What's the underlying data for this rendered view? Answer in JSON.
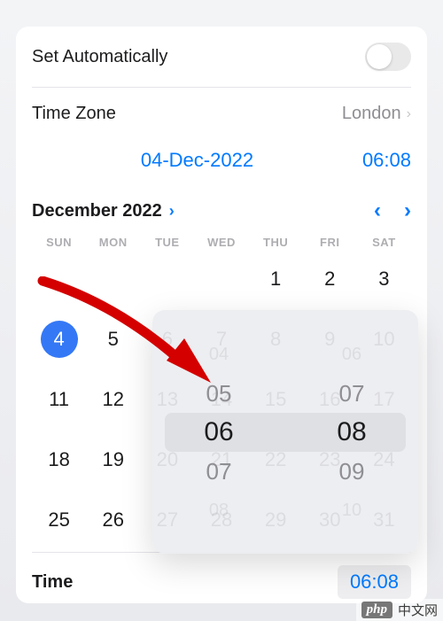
{
  "rows": {
    "set_auto_label": "Set Automatically",
    "set_auto_on": false,
    "time_zone_label": "Time Zone",
    "time_zone_value": "London"
  },
  "display": {
    "date": "04-Dec-2022",
    "time": "06:08"
  },
  "calendar": {
    "month_year": "December 2022",
    "weekdays": [
      "SUN",
      "MON",
      "TUE",
      "WED",
      "THU",
      "FRI",
      "SAT"
    ],
    "cells": [
      "",
      "",
      "",
      "",
      "1",
      "2",
      "3",
      "4",
      "5",
      "6",
      "7",
      "8",
      "9",
      "10",
      "11",
      "12",
      "13",
      "14",
      "15",
      "16",
      "17",
      "18",
      "19",
      "20",
      "21",
      "22",
      "23",
      "24",
      "25",
      "26",
      "27",
      "28",
      "29",
      "30",
      "31"
    ],
    "selected_day": "4"
  },
  "time_row": {
    "label": "Time",
    "value": "06:08"
  },
  "picker": {
    "hours": [
      "04",
      "05",
      "06",
      "07",
      "08"
    ],
    "minutes": [
      "06",
      "07",
      "08",
      "09",
      "10"
    ]
  },
  "watermark": {
    "logo": "php",
    "text": "中文网"
  }
}
